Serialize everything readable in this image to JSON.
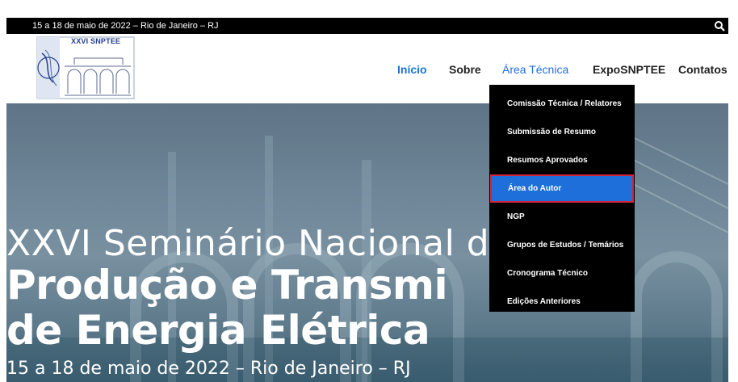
{
  "topbar": {
    "text": "15 a 18 de maio de 2022 – Rio de Janeiro – RJ",
    "search_icon": "search-icon"
  },
  "logo": {
    "text": "XXVI SNPTEE"
  },
  "nav": {
    "items": [
      {
        "label": "Início"
      },
      {
        "label": "Sobre"
      },
      {
        "label": "Área Técnica"
      },
      {
        "label": "ExpoSNPTEE"
      },
      {
        "label": "Contatos"
      }
    ]
  },
  "dropdown": {
    "items": [
      {
        "label": "Comissão Técnica / Relatores"
      },
      {
        "label": "Submissão de Resumo"
      },
      {
        "label": "Resumos Aprovados"
      },
      {
        "label": "Área do Autor"
      },
      {
        "label": "NGP"
      },
      {
        "label": "Grupos de Estudos / Temários"
      },
      {
        "label": "Cronograma Técnico"
      },
      {
        "label": "Edições Anteriores"
      }
    ],
    "active_index": 3
  },
  "hero": {
    "line1": "XXVI Seminário Nacional de",
    "line2": "Produção e Transmi",
    "line3": "de Energia Elétrica",
    "date": "15 a 18 de maio de 2022 – Rio de Janeiro – RJ"
  },
  "colors": {
    "accent": "#1e6fd9",
    "highlight_border": "#d0243a",
    "topbar_bg": "#000000",
    "dropdown_bg": "#000000"
  }
}
